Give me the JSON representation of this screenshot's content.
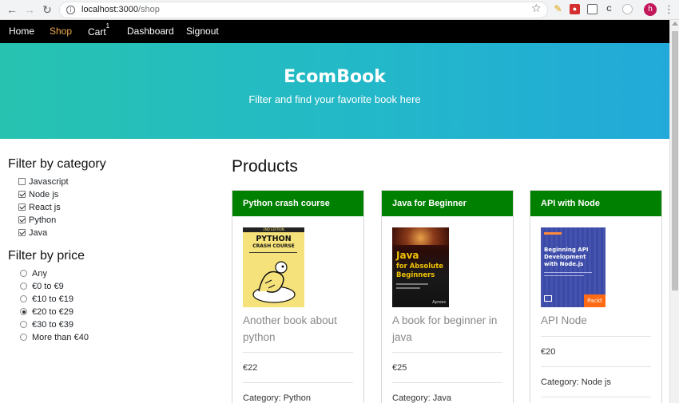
{
  "browser": {
    "url_host": "localhost:3000",
    "url_path": "/shop",
    "profile_initial": "h",
    "extensions": [
      "pen-icon",
      "record-icon",
      "cube-icon",
      "c-icon",
      "puzzle-icon"
    ]
  },
  "navbar": {
    "items": [
      {
        "label": "Home",
        "active": false
      },
      {
        "label": "Shop",
        "active": true
      },
      {
        "label": "Cart",
        "badge": "1",
        "active": false
      },
      {
        "label": "Dashboard",
        "active": false
      },
      {
        "label": "Signout",
        "active": false
      }
    ],
    "active_color": "#f0a94e"
  },
  "hero": {
    "title": "EcomBook",
    "subtitle": "Filter and find your favorite book here",
    "gradient": [
      "#27c3b0",
      "#22a9d9"
    ]
  },
  "filters": {
    "category_title": "Filter by category",
    "categories": [
      {
        "label": "Javascript",
        "checked": false
      },
      {
        "label": "Node js",
        "checked": true
      },
      {
        "label": "React js",
        "checked": true
      },
      {
        "label": "Python",
        "checked": true
      },
      {
        "label": "Java",
        "checked": true
      }
    ],
    "price_title": "Filter by price",
    "prices": [
      {
        "label": "Any",
        "checked": false
      },
      {
        "label": "€0 to €9",
        "checked": false
      },
      {
        "label": "€10 to €19",
        "checked": false
      },
      {
        "label": "€20 to €29",
        "checked": true
      },
      {
        "label": "€30 to €39",
        "checked": false
      },
      {
        "label": "More than €40",
        "checked": false
      }
    ]
  },
  "products": {
    "title": "Products",
    "header_color": "#008000",
    "items": [
      {
        "name": "Python crash course",
        "description": "Another book about python",
        "price": "€22",
        "category_label": "Category:",
        "category": "Python",
        "cover": {
          "line1": "PYTHON",
          "line2": "CRASH COURSE",
          "ribbon": "2ND EDITION"
        }
      },
      {
        "name": "Java for Beginner",
        "description": "A book for beginner in java",
        "price": "€25",
        "category_label": "Category:",
        "category": "Java",
        "cover": {
          "line1": "Java",
          "line2": "for Absolute",
          "line3": "Beginners",
          "publisher": "Apress"
        }
      },
      {
        "name": "API with Node",
        "description": "API Node",
        "price": "€20",
        "category_label": "Category:",
        "category": "Node js",
        "cover": {
          "line1": "Beginning API",
          "line2": "Development",
          "line3": "with Node.js",
          "publisher": "Packt"
        }
      }
    ]
  }
}
